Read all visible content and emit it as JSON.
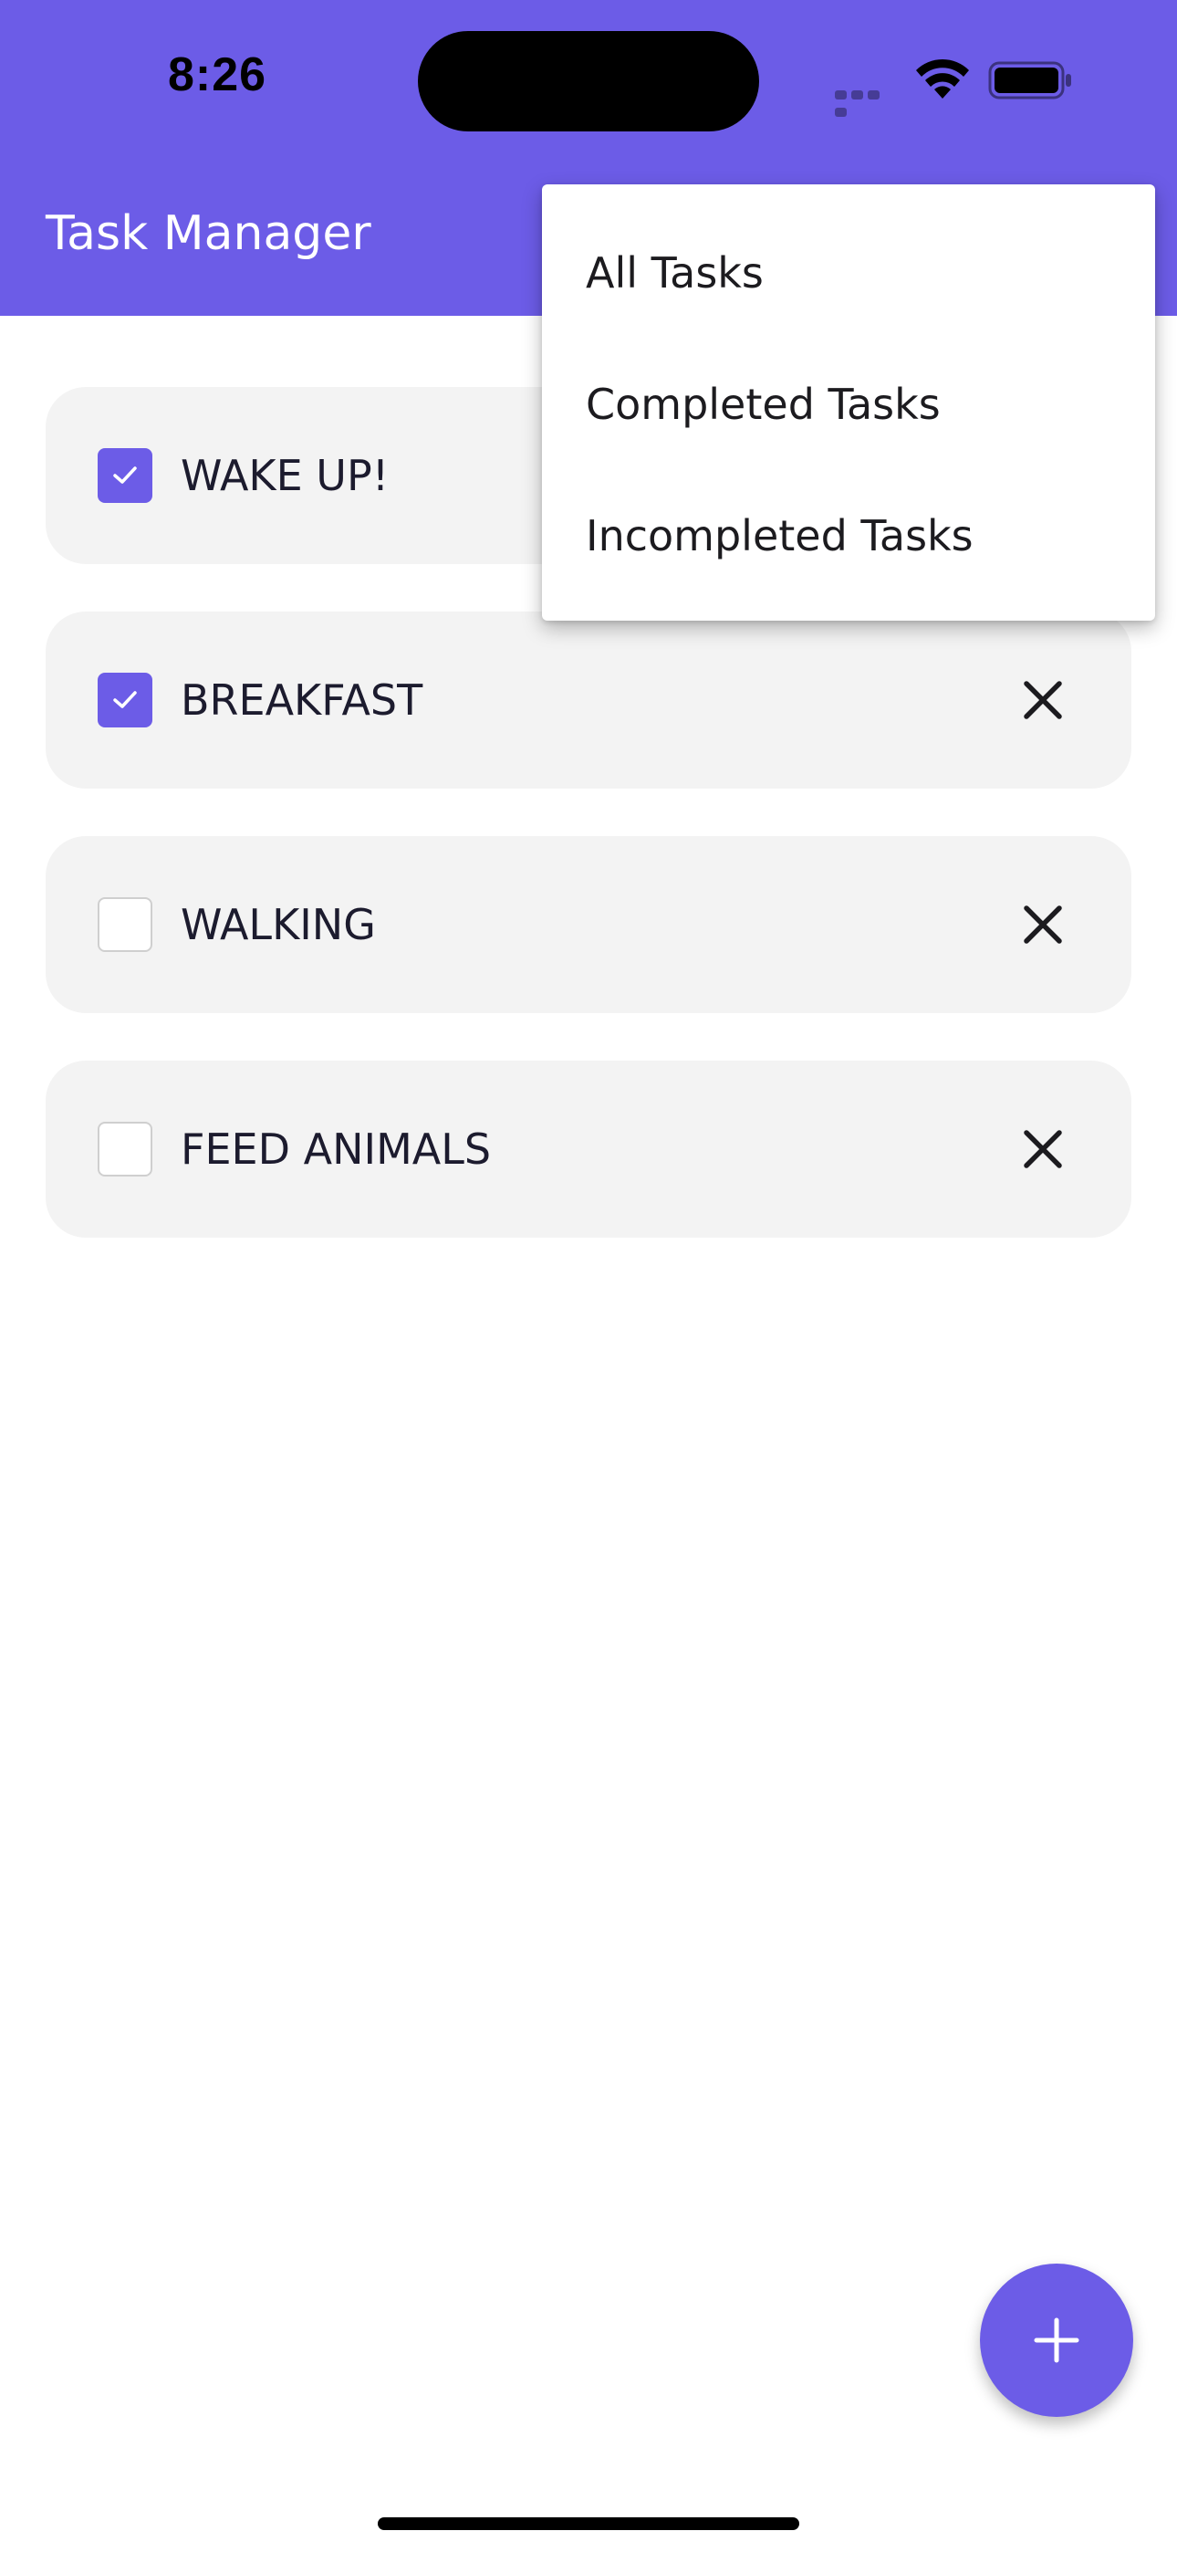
{
  "status_bar": {
    "time": "8:26"
  },
  "app_bar": {
    "title": "Task Manager"
  },
  "tasks": [
    {
      "label": "WAKE UP!",
      "checked": true
    },
    {
      "label": "BREAKFAST",
      "checked": true
    },
    {
      "label": "WALKING",
      "checked": false
    },
    {
      "label": "FEED ANIMALS",
      "checked": false
    }
  ],
  "filter_menu": {
    "items": [
      {
        "label": "All Tasks"
      },
      {
        "label": "Completed Tasks"
      },
      {
        "label": "Incompleted Tasks"
      }
    ]
  },
  "icons": {
    "check": "check-icon",
    "delete": "close-icon",
    "add": "plus-icon",
    "wifi": "wifi-icon",
    "battery": "battery-icon",
    "signal": "signal-icon"
  },
  "colors": {
    "accent": "#6c5ce7",
    "card_background": "#f3f3f3",
    "text": "#1c1b2e",
    "app_bar_text": "#ffffff"
  }
}
